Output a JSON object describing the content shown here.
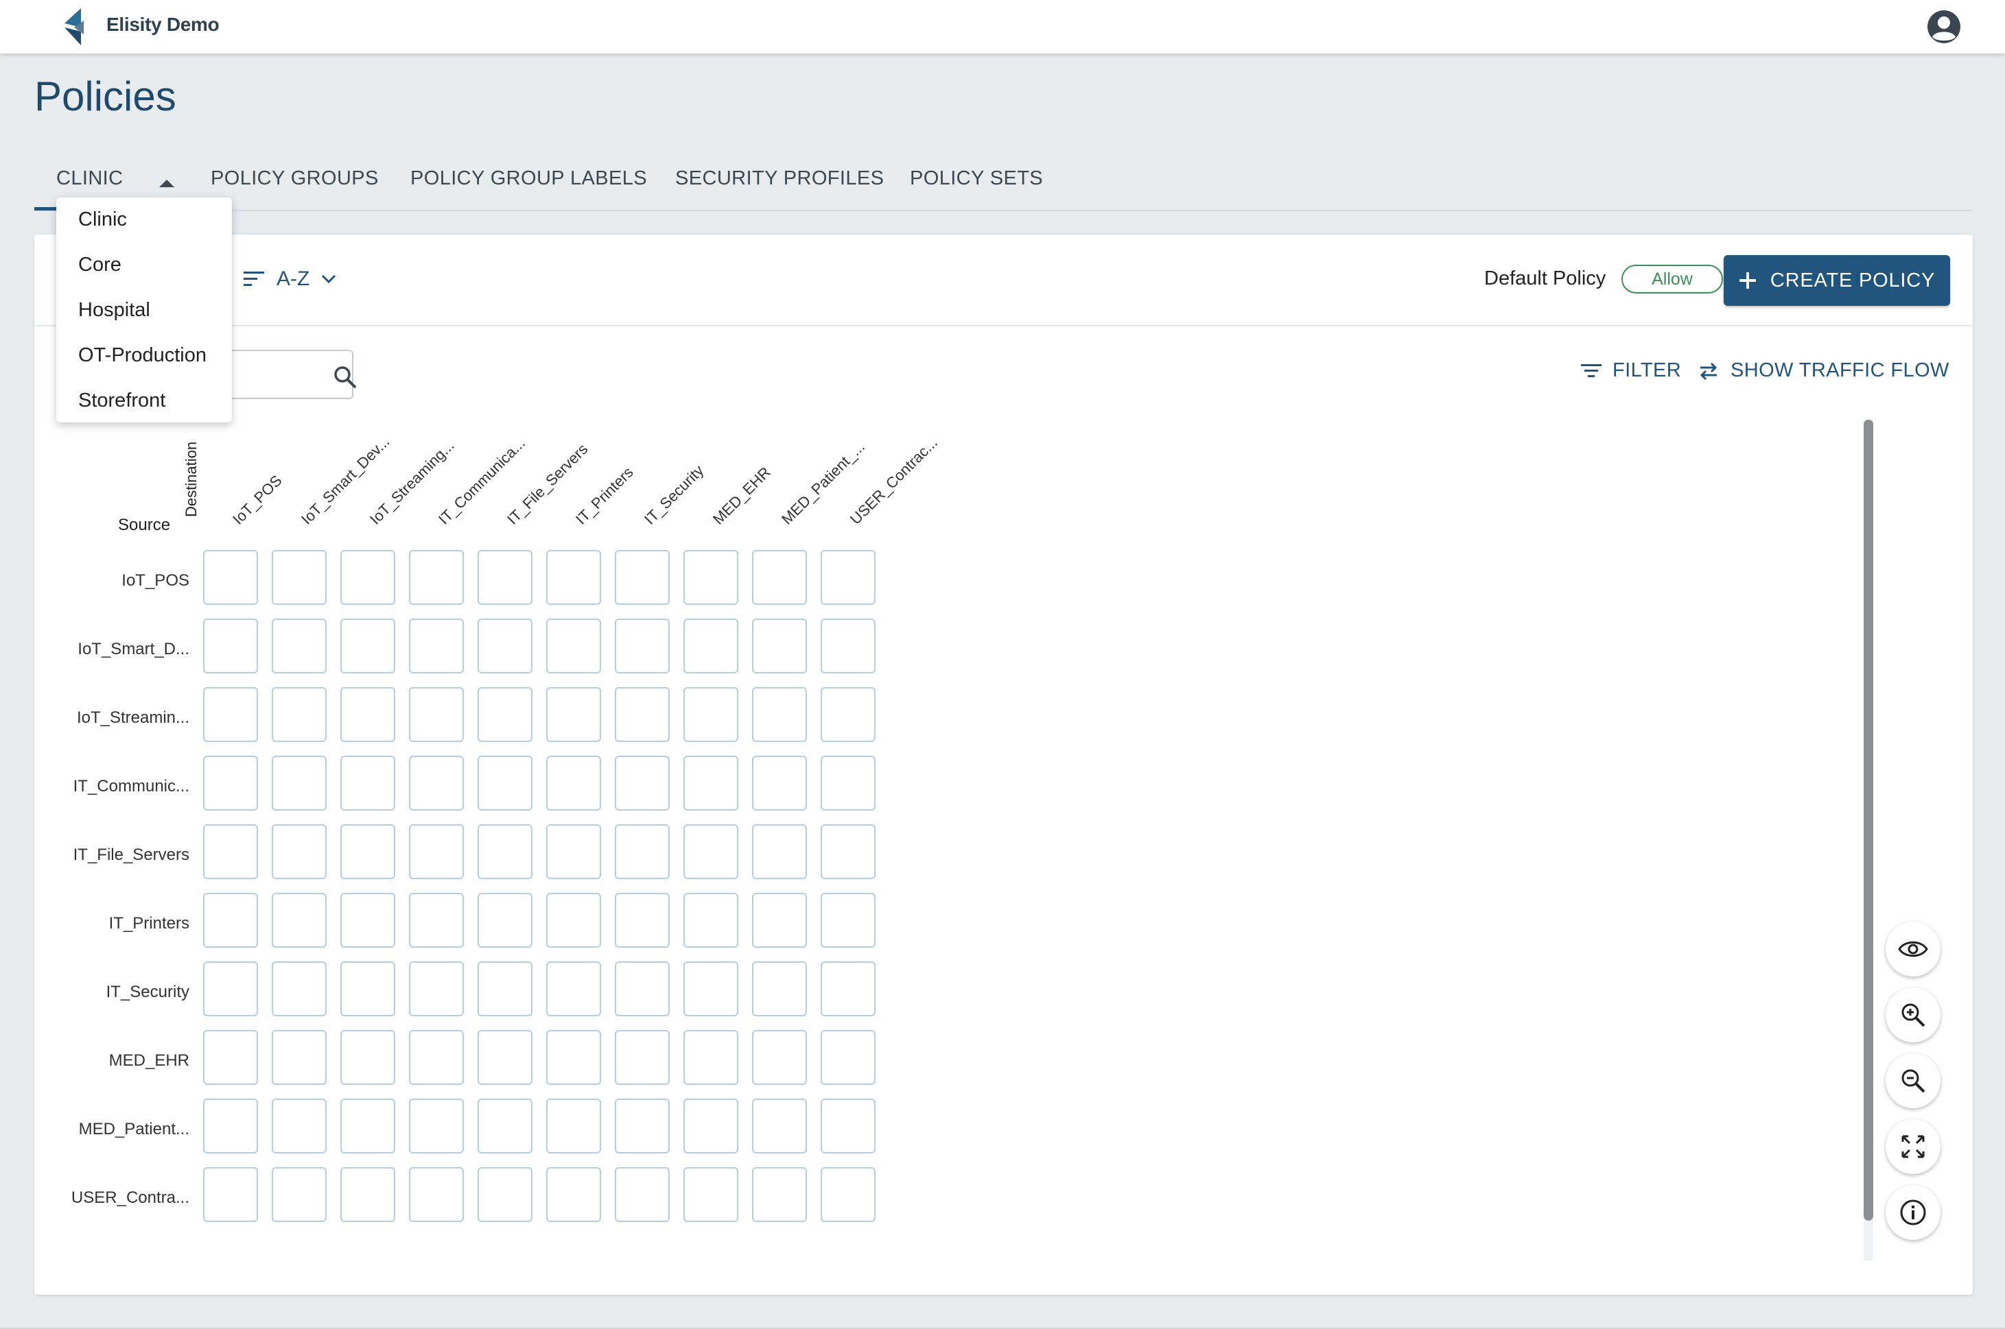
{
  "app": {
    "brand": "Elisity Demo"
  },
  "page": {
    "title": "Policies"
  },
  "tabs": [
    {
      "label": "CLINIC"
    },
    {
      "label": "POLICY GROUPS"
    },
    {
      "label": "POLICY GROUP LABELS"
    },
    {
      "label": "SECURITY PROFILES"
    },
    {
      "label": "POLICY SETS"
    }
  ],
  "site_dropdown": {
    "options": [
      "Clinic",
      "Core",
      "Hospital",
      "OT-Production",
      "Storefront"
    ]
  },
  "toolbar": {
    "sort_label": "A-Z",
    "default_policy_label": "Default Policy",
    "default_policy_value": "Allow",
    "create_label": "CREATE POLICY",
    "filter_label": "FILTER",
    "traffic_label": "SHOW TRAFFIC FLOW"
  },
  "matrix": {
    "destination_label": "Destination",
    "source_label": "Source",
    "columns": [
      "IoT_POS",
      "IoT_Smart_Dev...",
      "IoT_Streaming...",
      "IT_Communica...",
      "IT_File_Servers",
      "IT_Printers",
      "IT_Security",
      "MED_EHR",
      "MED_Patient_...",
      "USER_Contrac..."
    ],
    "rows": [
      "IoT_POS",
      "IoT_Smart_D...",
      "IoT_Streamin...",
      "IT_Communic...",
      "IT_File_Servers",
      "IT_Printers",
      "IT_Security",
      "MED_EHR",
      "MED_Patient...",
      "USER_Contra..."
    ]
  },
  "icons": {
    "fab_buttons": [
      "eye-icon",
      "zoom-in-icon",
      "zoom-out-icon",
      "fullscreen-icon",
      "info-icon"
    ]
  },
  "colors": {
    "primary": "#21557d",
    "allow": "#3e8e57",
    "cell_border": "#b6cde0"
  }
}
